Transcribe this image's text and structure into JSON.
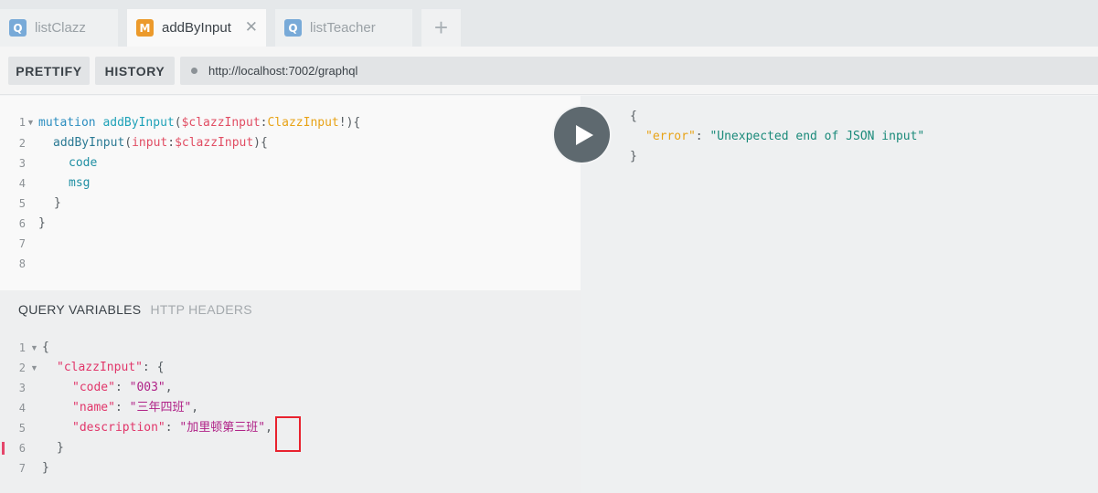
{
  "tabs": [
    {
      "badge": "Q",
      "label": "listClazz"
    },
    {
      "badge": "M",
      "label": "addByInput",
      "close": "✕"
    },
    {
      "badge": "Q",
      "label": "listTeacher"
    }
  ],
  "add_tab_label": "+",
  "toolbar": {
    "prettify": "PRETTIFY",
    "history": "HISTORY",
    "url": "http://localhost:7002/graphql"
  },
  "query": {
    "line_numbers": [
      "1",
      "2",
      "3",
      "4",
      "5",
      "6",
      "7",
      "8"
    ],
    "l1": {
      "kw": "mutation",
      "name": "addByInput",
      "open": "(",
      "var": "$clazzInput",
      "colon": ":",
      "type": "ClazzInput",
      "close": "!){"
    },
    "l2": {
      "name": "addByInput",
      "open": "(",
      "arg": "input",
      "colon": ":",
      "var": "$clazzInput",
      "close": "){"
    },
    "l3": "code",
    "l4": "msg",
    "l5": "}",
    "l6": "}"
  },
  "variables_panel": {
    "tab_active": "QUERY VARIABLES",
    "tab_inactive": "HTTP HEADERS"
  },
  "variables": {
    "line_numbers": [
      "1",
      "2",
      "3",
      "4",
      "5",
      "6",
      "7"
    ],
    "l1": "{",
    "l2": {
      "key": "\"clazzInput\"",
      "rest": ": {"
    },
    "l3": {
      "key": "\"code\"",
      "sep": ": ",
      "val": "\"003\"",
      "end": ","
    },
    "l4": {
      "key": "\"name\"",
      "sep": ": ",
      "val": "\"三年四班\"",
      "end": ","
    },
    "l5": {
      "key": "\"description\"",
      "sep": ": ",
      "val": "\"加里顿第三班\"",
      "end": ","
    },
    "l6": "}",
    "l7": "}"
  },
  "result": {
    "open": "{",
    "key": "\"error\"",
    "sep": ": ",
    "val": "\"Unexpected end of JSON input\"",
    "close": "}"
  },
  "colors": {
    "accent_error": "#e8222e",
    "run_button": "#5e696f",
    "mutation_badge": "#ec9a2b",
    "query_badge": "#78aad8"
  },
  "icons": {
    "run": "play-icon",
    "add": "plus-icon",
    "close": "close-icon"
  }
}
